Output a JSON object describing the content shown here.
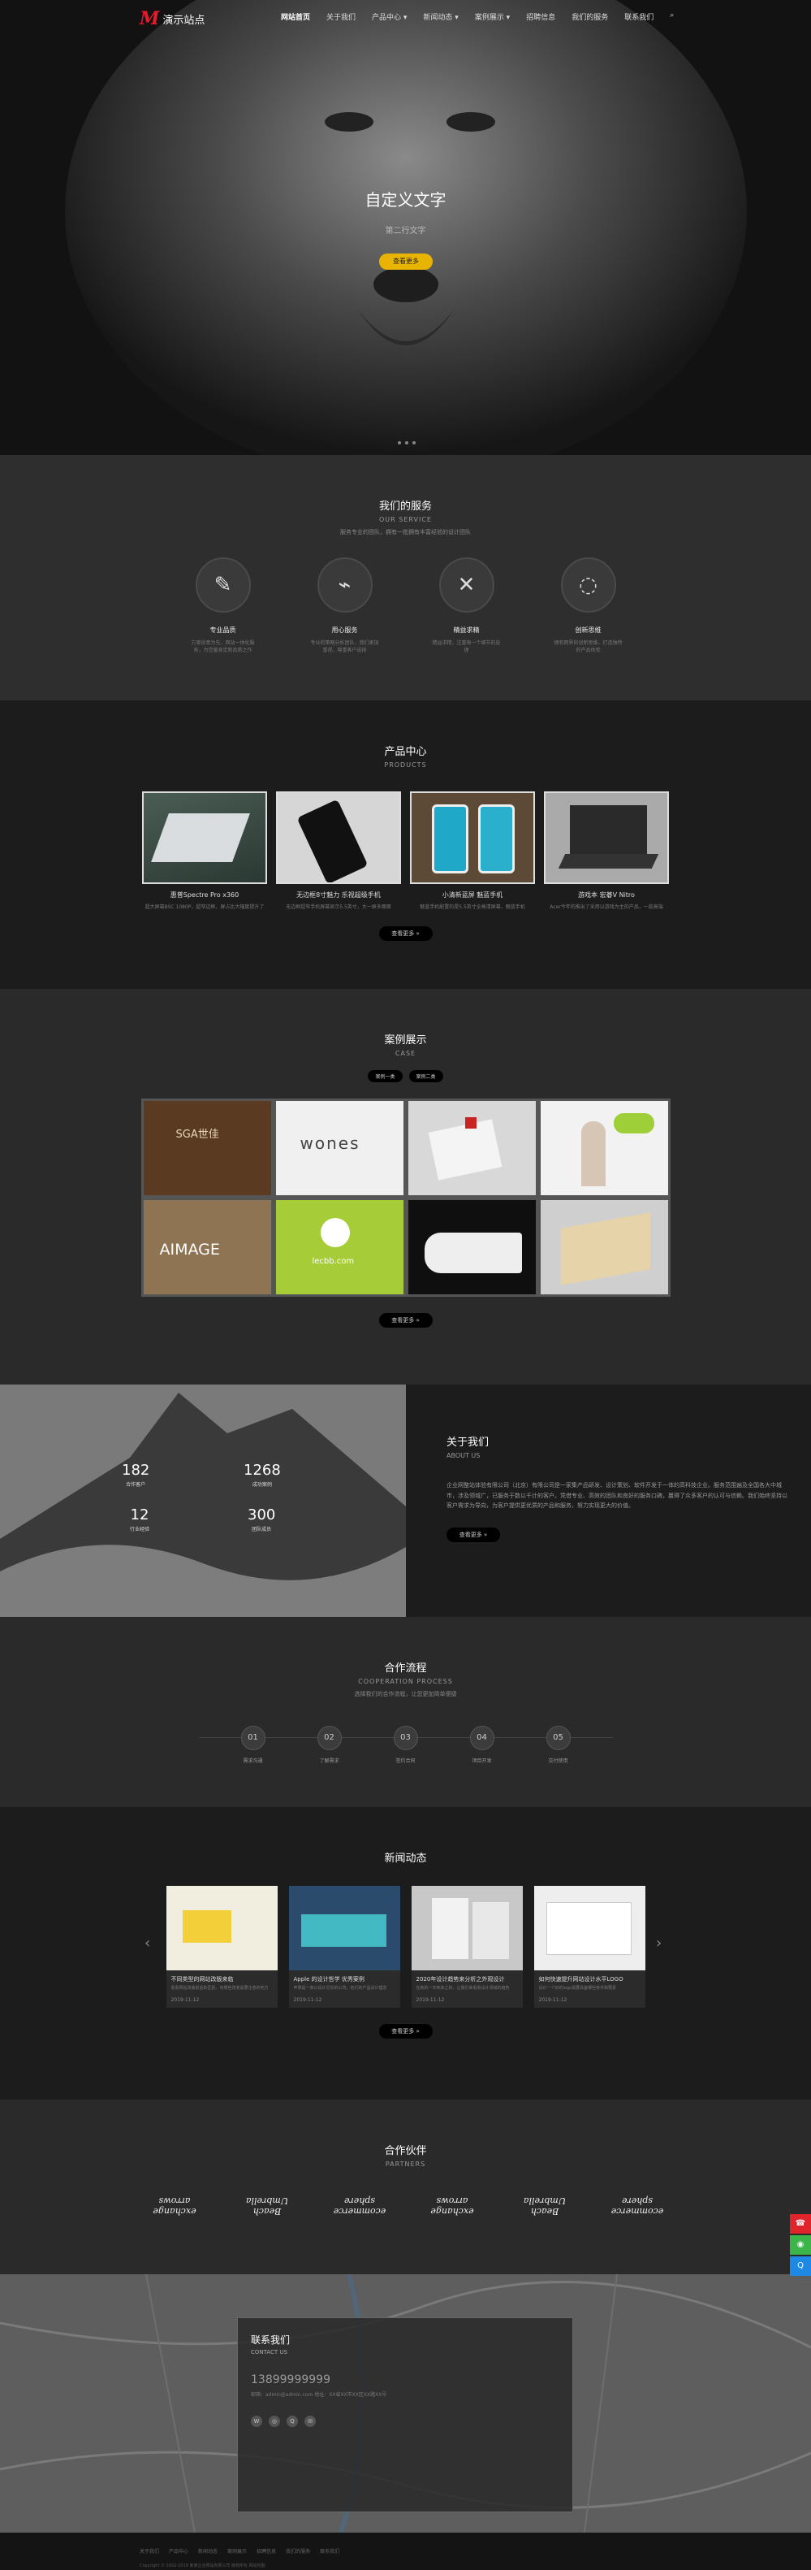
{
  "nav": {
    "logo_mark": "M",
    "logo_text": "演示站点",
    "items": [
      "网站首页",
      "关于我们",
      "产品中心 ▾",
      "新闻动态 ▾",
      "案例展示 ▾",
      "招聘信息",
      "我们的服务",
      "联系我们"
    ],
    "search_icon": "search-icon"
  },
  "hero": {
    "title": "自定义文字",
    "subtitle": "第二行文字",
    "button": "查看更多"
  },
  "services": {
    "title": "我们的服务",
    "subtitle": "OUR SERVICE",
    "desc": "服务专业的团队，拥有一批拥有丰富经验的设计团队",
    "items": [
      {
        "icon": "pencil-ruler-icon",
        "name": "专业品质",
        "desc": "方案创意为先，网站一体化服务，为您量身定制品质之作"
      },
      {
        "icon": "chart-board-icon",
        "name": "用心服务",
        "desc": "专业的策略分析团队，我们更加重视，尊重客户选择"
      },
      {
        "icon": "tools-icon",
        "name": "精益求精",
        "desc": "精益求精，注重每一个细节的处理"
      },
      {
        "icon": "lightbulb-icon",
        "name": "创新思维",
        "desc": "拥有跨界的创新思维，打造独特的产品体验"
      }
    ]
  },
  "products": {
    "title": "产品中心",
    "subtitle": "PRODUCTS",
    "more": "查看更多 »",
    "items": [
      {
        "name": "惠普Spectre Pro x360",
        "desc": "超大屏幕BSC 1080P，超窄边框，屏占比大幅度提升了"
      },
      {
        "name": "无边框8寸魅力 乐视超级手机",
        "desc": "无边框超窄手机屏幕显示5.5英寸，大一屏多面面"
      },
      {
        "name": "小清新蓝屏 魅蓝手机",
        "desc": "魅蓝手机配置的是5.5英寸全高清屏幕，魅蓝手机"
      },
      {
        "name": "游戏本 宏碁V Nitro",
        "desc": "Acer今年的推出了采用以游戏为主的产品，一款高端"
      }
    ]
  },
  "cases": {
    "title": "案例展示",
    "subtitle": "CASE",
    "tabs": [
      "案例一类",
      "案例二类"
    ],
    "more": "查看更多 »",
    "tiles": [
      "SGA世佳",
      "wones",
      "",
      "",
      "AIMAGE",
      "lecbb.com",
      "",
      ""
    ]
  },
  "about": {
    "title": "关于我们",
    "subtitle": "ABOUT US",
    "text": "企业网整站体验有限公司（北京）有限公司是一家集产品研发、设计策划、软件开发于一体的高科技企业。服务范围遍及全国各大中城市，涉及领域广，已服务于数以千计的客户。凭借专业、高效的团队和良好的服务口碑，赢得了众多客户的认可与信赖。我们始终坚持以客户需求为导向，为客户提供更优质的产品和服务，努力实现更大的价值。",
    "more": "查看更多 »",
    "stats": [
      {
        "value": "182",
        "label": "合作客户"
      },
      {
        "value": "1268",
        "label": "成功案例"
      },
      {
        "value": "12",
        "label": "行业经验"
      },
      {
        "value": "300",
        "label": "团队成员"
      }
    ]
  },
  "process": {
    "title": "合作流程",
    "subtitle": "COOPERATION PROCESS",
    "desc": "选择我们的合作流程，让您更加简单便捷",
    "steps": [
      {
        "n": "01",
        "l": "需求沟通"
      },
      {
        "n": "02",
        "l": "了解需求"
      },
      {
        "n": "03",
        "l": "签约合同"
      },
      {
        "n": "04",
        "l": "项目开发"
      },
      {
        "n": "05",
        "l": "交付使用"
      }
    ]
  },
  "news": {
    "title": "新闻动态",
    "more": "查看更多 »",
    "items": [
      {
        "title": "不同类型的网站改版来临",
        "desc": "看看网站改版前后的区别，有哪些改变需要注意的地方",
        "date": "2019-11-12"
      },
      {
        "title": "Apple 的设计哲学 优秀案例",
        "desc": "苹果是一家以设计见长的公司，他们的产品设计理念",
        "date": "2019-11-12"
      },
      {
        "title": "2020年设计趋势来分析之外观设计",
        "desc": "在新的一年到来之际，让我们来看看设计领域的趋势",
        "date": "2019-11-12"
      },
      {
        "title": "如何快速提升网站设计水平LOGO",
        "desc": "设计一个好的logo需要具备哪些条件和要素",
        "date": "2019-11-12"
      }
    ]
  },
  "partners": {
    "title": "合作伙伴",
    "subtitle": "PARTNERS",
    "logos": [
      "exchange arrows",
      "Beach Umbrella",
      "ecommerce sphere",
      "exchange arrows",
      "Beach Umbrella",
      "ecommerce sphere"
    ]
  },
  "contact": {
    "title": "联系我们",
    "subtitle": "CONTACT US",
    "phone": "13899999999",
    "address": "邮箱：admin@admin.com\n地址：XX省XX市XX区XX路XX号"
  },
  "footer": {
    "links": [
      "关于我们",
      "产品中心",
      "新闻动态",
      "案例展示",
      "招聘信息",
      "我们的服务",
      "联系我们"
    ],
    "copyright": "Copyright © 2002-2019 某某企业网站有限公司 版权所有 网站地图"
  },
  "side": [
    "phone-icon",
    "wechat-icon",
    "qq-icon"
  ]
}
